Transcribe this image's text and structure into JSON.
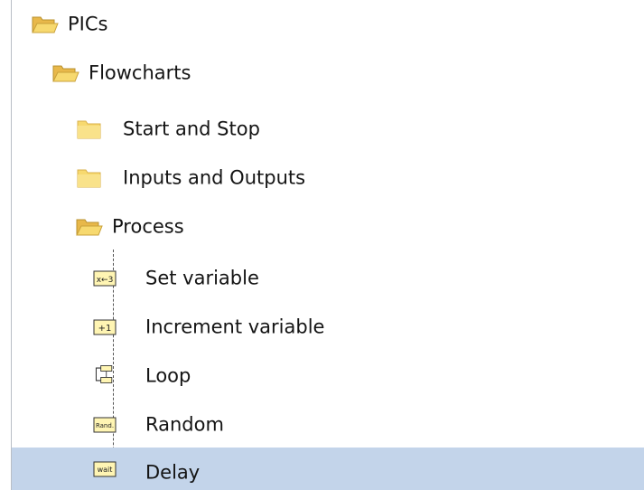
{
  "tree": {
    "items": [
      {
        "label": "PICs",
        "icon": "open-folder-icon"
      },
      {
        "label": "Flowcharts",
        "icon": "open-folder-icon"
      },
      {
        "label": "Start and Stop",
        "icon": "closed-folder-icon"
      },
      {
        "label": "Inputs and Outputs",
        "icon": "closed-folder-icon"
      },
      {
        "label": "Process",
        "icon": "open-folder-icon"
      },
      {
        "label": "Set variable",
        "icon": "set-variable-icon",
        "icon_text": "x←3"
      },
      {
        "label": "Increment variable",
        "icon": "increment-icon",
        "icon_text": "+1"
      },
      {
        "label": "Loop",
        "icon": "loop-icon"
      },
      {
        "label": "Random",
        "icon": "random-icon",
        "icon_text": "Rand."
      },
      {
        "label": "Delay",
        "icon": "wait-icon",
        "icon_text": "wait",
        "selected": true
      }
    ]
  },
  "colors": {
    "selection": "#c3d4ea",
    "folder": "#f5d76b",
    "node_fill": "#fff5b3"
  }
}
